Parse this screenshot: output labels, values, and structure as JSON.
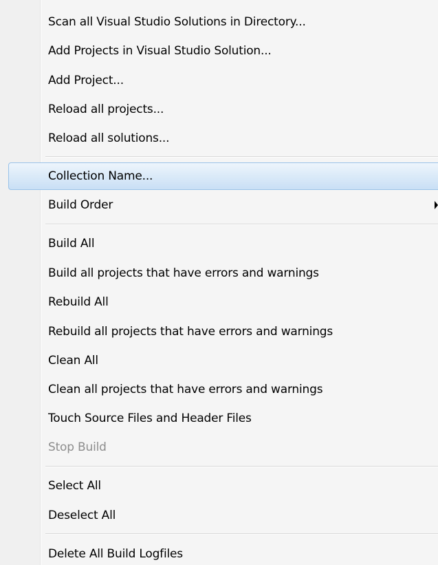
{
  "menu": {
    "items": [
      {
        "label": "Scan all Visual Studio Solutions in Directory..."
      },
      {
        "label": "Add Projects in Visual Studio Solution..."
      },
      {
        "label": "Add Project..."
      },
      {
        "label": "Reload all projects..."
      },
      {
        "label": "Reload all solutions..."
      },
      {
        "label": "Collection Name..."
      },
      {
        "label": "Build Order"
      },
      {
        "label": "Build All"
      },
      {
        "label": "Build all projects that have errors and warnings"
      },
      {
        "label": "Rebuild All"
      },
      {
        "label": "Rebuild all projects that have errors and warnings"
      },
      {
        "label": "Clean All"
      },
      {
        "label": "Clean all projects that have errors and warnings"
      },
      {
        "label": "Touch Source Files and Header Files"
      },
      {
        "label": "Stop Build"
      },
      {
        "label": "Select All"
      },
      {
        "label": "Deselect All"
      },
      {
        "label": "Delete All Build Logfiles"
      }
    ],
    "highlighted_item": "Collection Name...",
    "disabled_item": "Stop Build"
  },
  "colors": {
    "highlight_border": "#99c2e8",
    "highlight_fill": "#d9e9f8",
    "disabled_text": "#8d8d8d",
    "gutter": "#f0f0f0"
  }
}
